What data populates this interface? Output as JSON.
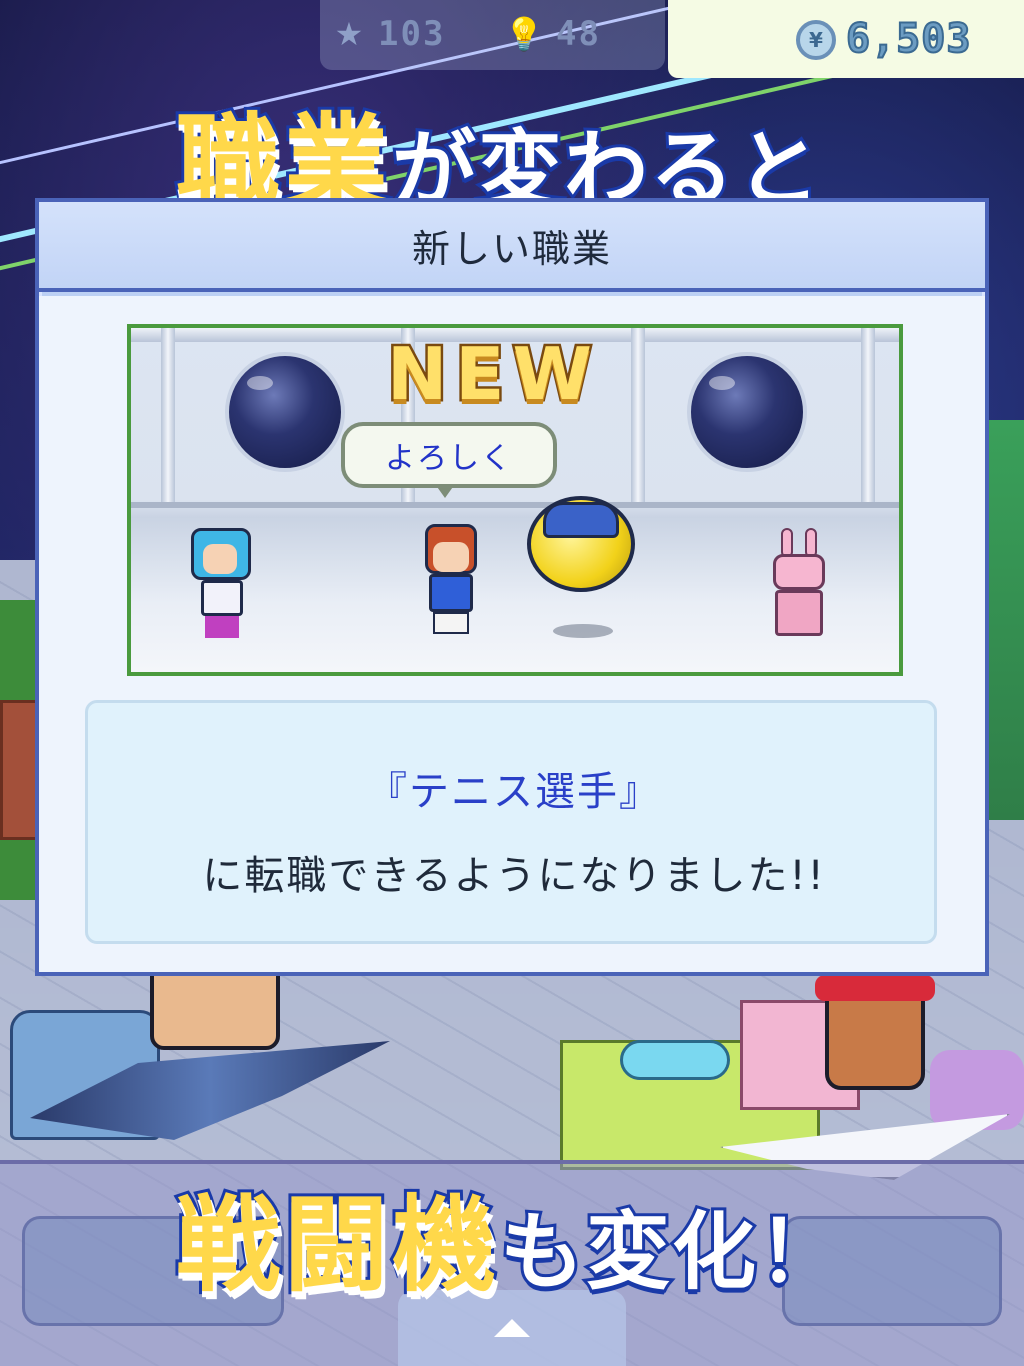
{
  "hud": {
    "stat1_value": "103",
    "stat1_icon": "star-icon",
    "stat2_value": "48",
    "stat2_icon": "lightbulb-icon",
    "money_value": "6,503",
    "money_icon": "coin-icon"
  },
  "headline_top": {
    "keyword": "職業",
    "rest": "が変わると"
  },
  "dialog": {
    "title": "新しい職業",
    "badge": "NEW",
    "speech": "よろしく",
    "job_name": "『テニス選手』",
    "message": "に転職できるようになりました!!"
  },
  "headline_bottom": {
    "keyword": "戦闘機",
    "rest": "も変化！"
  },
  "colors": {
    "accent_yellow": "#ffd84a",
    "outline_blue": "#1a3aa8",
    "job_name_blue": "#2a40c8",
    "dialog_border": "#4a63b8"
  }
}
